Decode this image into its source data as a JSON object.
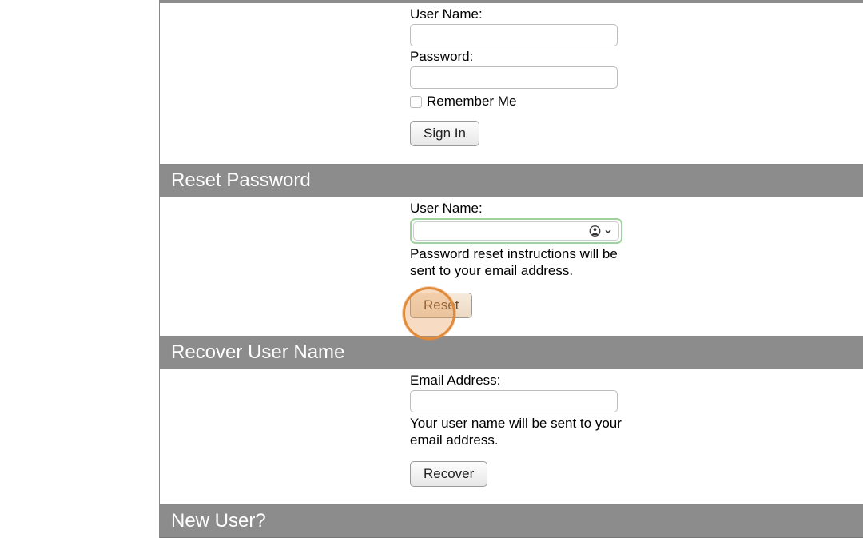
{
  "signIn": {
    "userNameLabel": "User Name:",
    "passwordLabel": "Password:",
    "rememberLabel": "Remember Me",
    "buttonLabel": "Sign In"
  },
  "resetPassword": {
    "header": "Reset Password",
    "userNameLabel": "User Name:",
    "desc": "Password reset instructions will be sent to your email address.",
    "buttonLabel": "Reset"
  },
  "recoverUser": {
    "header": "Recover User Name",
    "emailLabel": "Email Address:",
    "desc": "Your user name will be sent to your email address.",
    "buttonLabel": "Recover"
  },
  "newUser": {
    "header": "New User?"
  }
}
